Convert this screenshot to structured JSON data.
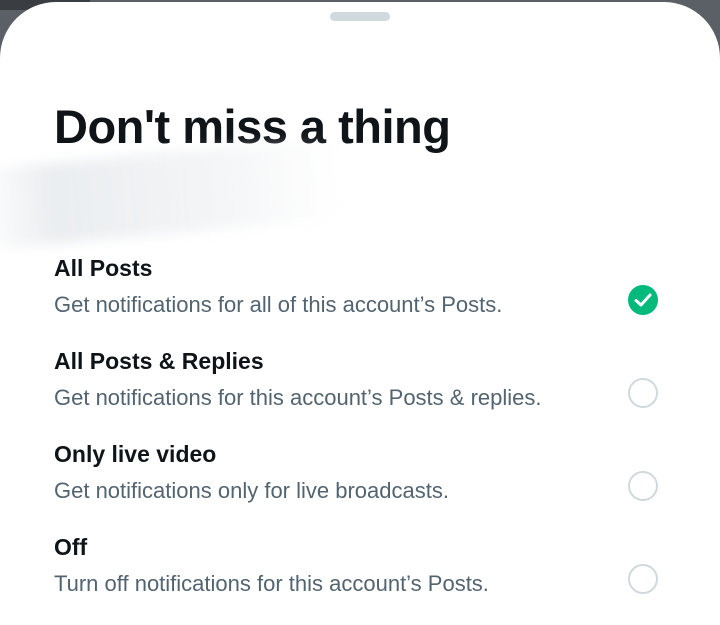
{
  "sheet": {
    "title": "Don't miss a thing"
  },
  "options": [
    {
      "label": "All Posts",
      "description": "Get notifications for all of this account’s Posts.",
      "selected": true
    },
    {
      "label": "All Posts & Replies",
      "description": "Get notifications for this account’s Posts & replies.",
      "selected": false
    },
    {
      "label": "Only live video",
      "description": "Get notifications only for live broadcasts.",
      "selected": false
    },
    {
      "label": "Off",
      "description": "Turn off notifications for this account’s Posts.",
      "selected": false
    }
  ],
  "colors": {
    "selected_accent": "#00ba7c",
    "unselected_ring": "#cfd9de",
    "primary_text": "#0f1419",
    "secondary_text": "#536471"
  },
  "icons": {
    "selected": "checkmark-icon"
  }
}
